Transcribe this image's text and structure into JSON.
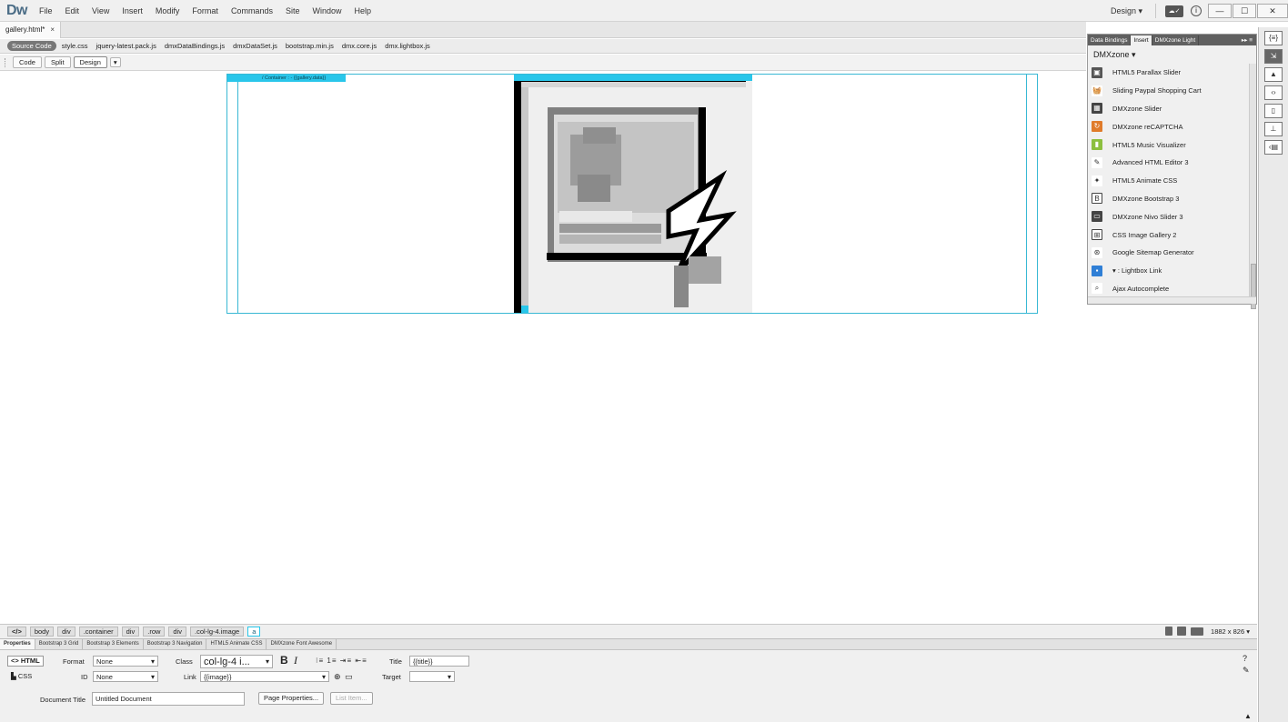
{
  "app": {
    "logo": "Dw",
    "menu": [
      "File",
      "Edit",
      "View",
      "Insert",
      "Modify",
      "Format",
      "Commands",
      "Site",
      "Window",
      "Help"
    ],
    "workspace": "Design ▾",
    "window_controls": [
      "—",
      "☐",
      "✕"
    ]
  },
  "document": {
    "tab_label": "gallery.html*",
    "tab_close": "×",
    "source_code": "Source Code",
    "related_files": [
      "style.css",
      "jquery-latest.pack.js",
      "dmxDataBindings.js",
      "dmxDataSet.js",
      "bootstrap.min.js",
      "dmx.core.js",
      "dmx.lightbox.js"
    ],
    "view_buttons": [
      "Code",
      "Split",
      "Design"
    ]
  },
  "canvas": {
    "container_label": "/ Container : - {{gallery.data}}"
  },
  "insert_panel": {
    "tabs": [
      "Data Bindings",
      "Insert",
      "DMXzone Light"
    ],
    "active_tab": "Insert",
    "category": "DMXzone ▾",
    "items": [
      {
        "label": "HTML5 Parallax Slider",
        "icon": "parallax-slider-icon",
        "color": "#555555"
      },
      {
        "label": "Sliding Paypal Shopping Cart",
        "icon": "shopping-basket-icon",
        "color": "#333333"
      },
      {
        "label": "DMXzone Slider",
        "icon": "slider-icon",
        "color": "#444444"
      },
      {
        "label": "DMXzone reCAPTCHA",
        "icon": "recaptcha-icon",
        "color": "#e07b2a"
      },
      {
        "label": "HTML5 Music Visualizer",
        "icon": "music-visualizer-icon",
        "color": "#8cbf3f"
      },
      {
        "label": "Advanced HTML Editor 3",
        "icon": "html-editor-icon",
        "color": "#555555"
      },
      {
        "label": "HTML5 Animate CSS",
        "icon": "animate-css-icon",
        "color": "#555555"
      },
      {
        "label": "DMXzone Bootstrap 3",
        "icon": "bootstrap-icon",
        "color": "#444444"
      },
      {
        "label": "DMXzone Nivo Slider 3",
        "icon": "nivo-slider-icon",
        "color": "#444444"
      },
      {
        "label": "CSS Image Gallery 2",
        "icon": "image-gallery-icon",
        "color": "#444444"
      },
      {
        "label": "Google Sitemap Generator",
        "icon": "sitemap-icon",
        "color": "#444444"
      },
      {
        "label": "▾ : Lightbox Link",
        "icon": "lightbox-icon",
        "color": "#2f7fd6"
      },
      {
        "label": "Ajax Autocomplete",
        "icon": "search-icon",
        "color": "#333333"
      }
    ]
  },
  "tag_selector": {
    "code_tag": "</>",
    "tags": [
      "body",
      "div",
      ".container",
      "div",
      ".row",
      "div",
      ".col-lg-4.image",
      "a"
    ],
    "screen_size": "1882 x 826 ▾"
  },
  "properties": {
    "tabs": [
      "Properties",
      "Bootstrap 3 Grid",
      "Bootstrap 3 Elements",
      "Bootstrap 3 Navigation",
      "HTML5 Animate CSS",
      "DMXzone Font Awesome"
    ],
    "html_mode": "<> HTML",
    "css_mode": "CSS",
    "format_label": "Format",
    "format_value": "None",
    "id_label": "ID",
    "id_value": "None",
    "class_label": "Class",
    "class_value": "col-lg-4 i...",
    "link_label": "Link",
    "link_value": "{{image}}",
    "title_label": "Title",
    "title_value": "{{title}}",
    "target_label": "Target",
    "target_value": "",
    "doc_title_label": "Document Title",
    "doc_title_value": "Untitled Document",
    "page_properties": "Page Properties...",
    "list_item": "List Item..."
  },
  "right_strip": {
    "icons": [
      "code-brackets-icon",
      "insert-icon",
      "image-icon",
      "css-designer-icon",
      "file-icon",
      "dom-tree-icon",
      "snippets-icon"
    ]
  }
}
